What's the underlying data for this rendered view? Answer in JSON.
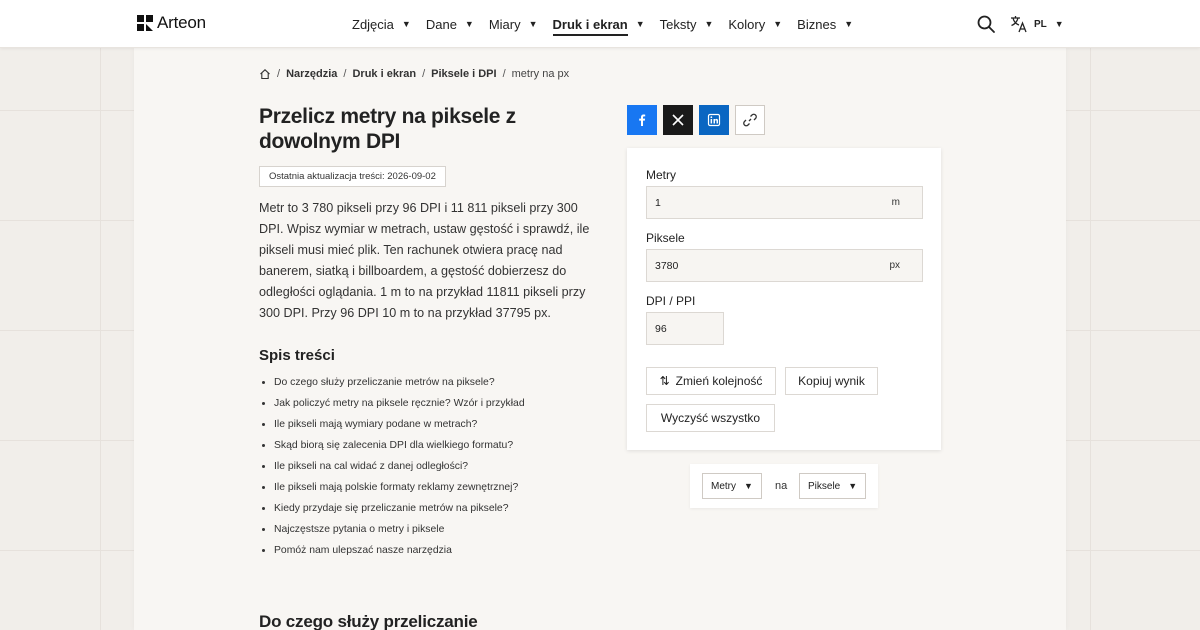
{
  "brand": {
    "name": "Arteon"
  },
  "nav": [
    {
      "label": "Zdjęcia",
      "active": false
    },
    {
      "label": "Dane",
      "active": false
    },
    {
      "label": "Miary",
      "active": false
    },
    {
      "label": "Druk i ekran",
      "active": true
    },
    {
      "label": "Teksty",
      "active": false
    },
    {
      "label": "Kolory",
      "active": false
    },
    {
      "label": "Biznes",
      "active": false
    }
  ],
  "header": {
    "lang": "PL"
  },
  "breadcrumb": {
    "items": [
      "Narzędzia",
      "Druk i ekran",
      "Piksele i DPI"
    ],
    "current": "metry na px"
  },
  "article": {
    "title": "Przelicz metry na piksele z dowolnym DPI",
    "updated": "Ostatnia aktualizacja treści: 2026-09-02",
    "intro": "Metr to 3 780 pikseli przy 96 DPI i 11 811 pikseli przy 300 DPI. Wpisz wymiar w metrach, ustaw gęstość i sprawdź, ile pikseli musi mieć plik. Ten rachunek otwiera pracę nad banerem, siatką i billboardem, a gęstość dobierzesz do odległości oglądania. 1 m to na przykład 11811 pikseli przy 300 DPI. Przy 96 DPI 10 m to na przykład 37795 px.",
    "toc_title": "Spis treści",
    "toc": [
      "Do czego służy przeliczanie metrów na piksele?",
      "Jak policzyć metry na piksele ręcznie? Wzór i przykład",
      "Ile pikseli mają wymiary podane w metrach?",
      "Skąd biorą się zalecenia DPI dla wielkiego formatu?",
      "Ile pikseli na cal widać z danej odległości?",
      "Ile pikseli mają polskie formaty reklamy zewnętrznej?",
      "Kiedy przydaje się przeliczanie metrów na piksele?",
      "Najczęstsze pytania o metry i piksele",
      "Pomóż nam ulepszać nasze narzędzia"
    ],
    "next_section": "Do czego służy przeliczanie"
  },
  "converter": {
    "meters_label": "Metry",
    "meters_value": "1",
    "meters_unit": "m",
    "pixels_label": "Piksele",
    "pixels_value": "3780",
    "pixels_unit": "px",
    "dpi_label": "DPI / PPI",
    "dpi_value": "96",
    "swap_label": "Zmień kolejność",
    "copy_label": "Kopiuj wynik",
    "clear_label": "Wyczyść wszystko"
  },
  "units": {
    "from": "Metry",
    "joiner": "na",
    "to": "Piksele"
  },
  "colors": {
    "facebook": "#1877f2",
    "x": "#1a1a1a",
    "linkedin": "#0a66c2"
  }
}
